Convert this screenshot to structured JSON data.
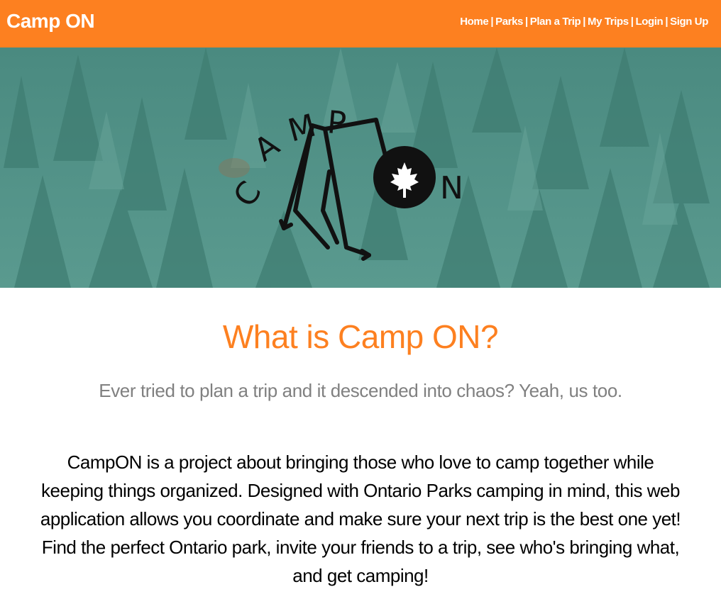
{
  "navbar": {
    "brand": "Camp ON",
    "links": [
      {
        "label": "Home"
      },
      {
        "label": "Parks"
      },
      {
        "label": "Plan a Trip"
      },
      {
        "label": "My Trips"
      },
      {
        "label": "Login"
      },
      {
        "label": "Sign Up"
      }
    ],
    "separator": "|"
  },
  "hero": {
    "logo_text_top": "CAMP",
    "logo_text_end": "N",
    "logo_icon": "maple-leaf-icon"
  },
  "main": {
    "headline": "What is Camp ON?",
    "tagline": "Ever tried to plan a trip and it descended into chaos? Yeah, us too.",
    "description": "CampON is a project about bringing those who love to camp together while keeping things organized. Designed with Ontario Parks camping in mind, this web application allows you coordinate and make sure your next trip is the best one yet! Find the perfect Ontario park, invite your friends to a trip, see who's bringing what, and get camping!"
  },
  "colors": {
    "accent": "#fd8020",
    "tagline": "#808080",
    "hero_bg": "#4f8d82"
  }
}
